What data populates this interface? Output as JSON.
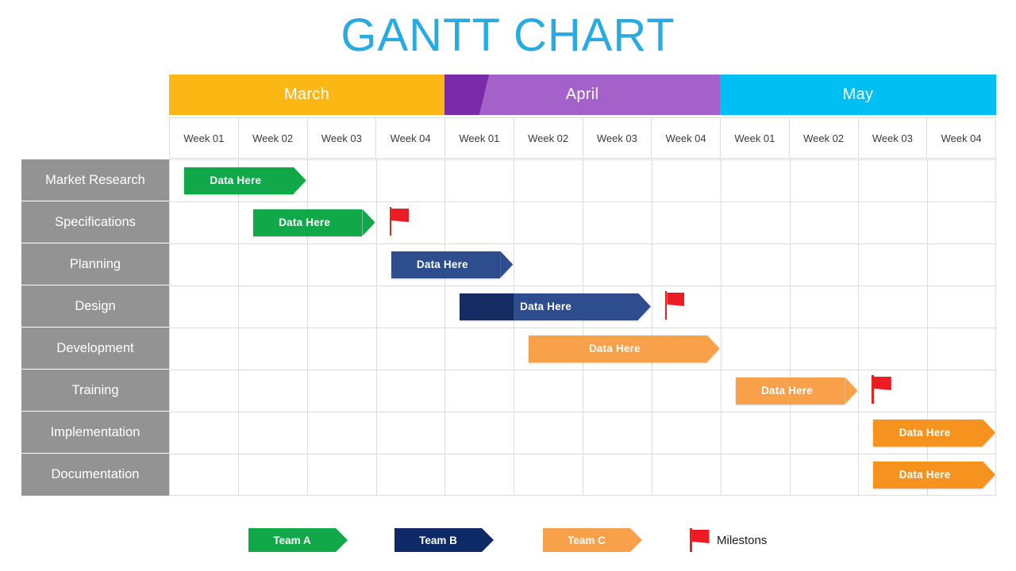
{
  "title": "GANTT CHART",
  "colors": {
    "title": "#29ABE2",
    "march": "#FBB713",
    "april": "#A361C9",
    "april_wedge": "#7A2CA8",
    "may": "#00BFF3",
    "task_label_bg": "#939393",
    "team_a": "#11A84A",
    "team_b": "#2D4D8E",
    "team_b_dark": "#152C63",
    "team_c": "#F9A14A",
    "team_c_alt": "#F5931E",
    "milestone": "#ED1C24",
    "grid_line": "#dcdcdc"
  },
  "months": [
    {
      "label": "March"
    },
    {
      "label": "April"
    },
    {
      "label": "May"
    }
  ],
  "week_headers": [
    "Week 01",
    "Week 02",
    "Week 03",
    "Week 04",
    "Week 01",
    "Week 02",
    "Week 03",
    "Week 04",
    "Week 01",
    "Week 02",
    "Week 03",
    "Week 04"
  ],
  "tasks": [
    {
      "label": "Market Research"
    },
    {
      "label": "Specifications"
    },
    {
      "label": "Planning"
    },
    {
      "label": "Design"
    },
    {
      "label": "Development"
    },
    {
      "label": "Training"
    },
    {
      "label": "Implementation"
    },
    {
      "label": "Documentation"
    }
  ],
  "chart_data": {
    "type": "bar",
    "title": "GANTT CHART",
    "xlabel": "",
    "ylabel": "",
    "x_unit": "week",
    "x_columns": 12,
    "categories": [
      "Market Research",
      "Specifications",
      "Planning",
      "Design",
      "Development",
      "Training",
      "Implementation",
      "Documentation"
    ],
    "legend_position": "bottom",
    "grid": true,
    "series": [
      {
        "name": "Team A",
        "color": "#11A84A"
      },
      {
        "name": "Team B",
        "color": "#2D4D8E"
      },
      {
        "name": "Team C",
        "color": "#F9A14A"
      }
    ],
    "bars": [
      {
        "task": "Market Research",
        "team": "Team A",
        "label": "Data Here",
        "start_week": 1,
        "end_week": 2,
        "row": 0
      },
      {
        "task": "Specifications",
        "team": "Team A",
        "label": "Data Here",
        "start_week": 2,
        "end_week": 3,
        "row": 1
      },
      {
        "task": "Planning",
        "team": "Team B",
        "label": "Data Here",
        "start_week": 4,
        "end_week": 5,
        "row": 2
      },
      {
        "task": "Design",
        "team": "Team B",
        "label": "Data Here",
        "start_week": 5,
        "end_week": 7,
        "row": 3
      },
      {
        "task": "Development",
        "team": "Team C",
        "label": "Data Here",
        "start_week": 6,
        "end_week": 8,
        "row": 4
      },
      {
        "task": "Training",
        "team": "Team C",
        "label": "Data Here",
        "start_week": 9,
        "end_week": 10,
        "row": 5
      },
      {
        "task": "Implementation",
        "team": "Team C",
        "label": "Data Here",
        "start_week": 11,
        "end_week": 12,
        "row": 6
      },
      {
        "task": "Documentation",
        "team": "Team C",
        "label": "Data Here",
        "start_week": 11,
        "end_week": 12,
        "row": 7
      }
    ],
    "milestones": [
      {
        "task": "Specifications",
        "week": 4,
        "row": 1
      },
      {
        "task": "Design",
        "week": 8,
        "row": 3
      },
      {
        "task": "Training",
        "week": 11,
        "row": 5
      }
    ]
  },
  "bar_label": "Data Here",
  "legend": {
    "team_a": "Team A",
    "team_b": "Team B",
    "team_c": "Team C",
    "milestone": "Milestons"
  }
}
